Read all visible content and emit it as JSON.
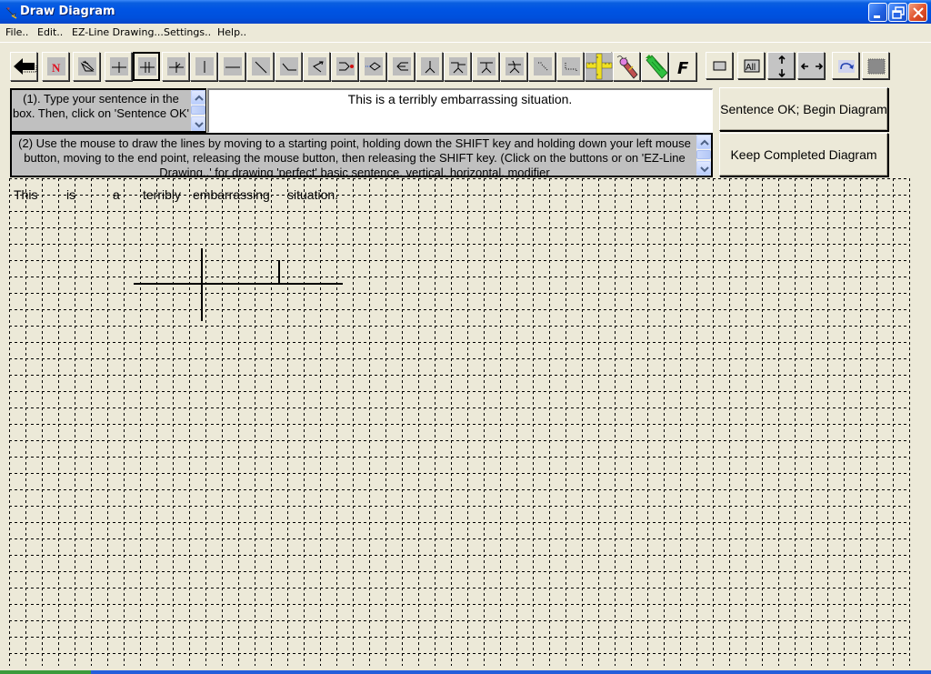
{
  "window": {
    "title": "Draw Diagram",
    "icon": "pencil-arrow-icon",
    "controls": [
      "minimize",
      "restore",
      "close"
    ]
  },
  "menu": {
    "items": [
      {
        "label": "File.."
      },
      {
        "label": "Edit.."
      },
      {
        "label": "EZ-Line Drawing..."
      },
      {
        "label": "Settings.."
      },
      {
        "label": "Help.."
      }
    ]
  },
  "toolbar": {
    "tools": [
      {
        "name": "back",
        "icon": "back-arrow-icon"
      },
      {
        "name": "new",
        "icon": "new-n-icon",
        "glyph": "N",
        "color": "#e01020"
      },
      {
        "name": "eraser-diagonal",
        "icon": "eraser-icon"
      },
      {
        "name": "subject-verb-divider",
        "icon": "cross-line-icon"
      },
      {
        "name": "double-divider",
        "icon": "double-cross-icon",
        "pressed": true
      },
      {
        "name": "slanted-divider",
        "icon": "slant-cross-icon"
      },
      {
        "name": "vertical-line",
        "icon": "vertical-line-icon"
      },
      {
        "name": "horizontal-line",
        "icon": "horizontal-line-icon"
      },
      {
        "name": "diagonal-line",
        "icon": "diagonal-line-icon"
      },
      {
        "name": "modifier-line",
        "icon": "modifier-line-icon"
      },
      {
        "name": "zigzag-line",
        "icon": "zigzag-icon"
      },
      {
        "name": "conjunction-join",
        "icon": "join-dot-icon"
      },
      {
        "name": "diamond-join",
        "icon": "diamond-icon"
      },
      {
        "name": "fork-join",
        "icon": "fork-icon"
      },
      {
        "name": "pedestal",
        "icon": "pedestal-icon"
      },
      {
        "name": "pedestal-left",
        "icon": "pedestal-left-icon"
      },
      {
        "name": "pedestal-stand",
        "icon": "pedestal-stand-icon"
      },
      {
        "name": "pedestal-slanted",
        "icon": "pedestal-slant-icon"
      },
      {
        "name": "dotted-diagonal",
        "icon": "dotted-diagonal-icon"
      },
      {
        "name": "dotted-corner",
        "icon": "dotted-corner-icon"
      },
      {
        "name": "ruler",
        "icon": "ruler-icon"
      },
      {
        "name": "pencil-eraser",
        "icon": "pencil-eraser-icon"
      },
      {
        "name": "green-pencil",
        "icon": "green-pencil-icon"
      },
      {
        "name": "font",
        "icon": "font-f-icon",
        "glyph": "F"
      }
    ],
    "tools2": [
      {
        "name": "rectangle-select",
        "icon": "rectangle-icon"
      },
      {
        "name": "select-all",
        "icon": "select-all-icon",
        "glyph": "All"
      },
      {
        "name": "move-vertical",
        "icon": "vertical-arrows-icon"
      },
      {
        "name": "move-horizontal",
        "icon": "horizontal-arrows-icon"
      },
      {
        "name": "redo",
        "icon": "redo-icon"
      },
      {
        "name": "grid-toggle",
        "icon": "grid-icon"
      }
    ]
  },
  "instructions": {
    "step1": "(1). Type your sentence in the box. Then, click on 'Sentence OK'",
    "step2": "(2) Use the mouse to draw the lines by moving to a starting point, holding down the SHIFT key and holding down your left mouse button, moving to the end point, releasing the mouse button, then releasing the SHIFT key. (Click on the buttons or on 'EZ-Line Drawing..' for drawing 'perfect' basic sentence, vertical, horizontal, modifier"
  },
  "sentence": {
    "value": "This is a terribly embarrassing situation."
  },
  "buttons": {
    "sentence_ok": "Sentence OK; Begin Diagram",
    "keep": "Keep Completed Diagram"
  },
  "canvas": {
    "words": [
      "This",
      "is",
      "a",
      "terribly",
      "embarrassing",
      "situation."
    ],
    "line_color": "#000000",
    "grid_color": "#000000"
  }
}
